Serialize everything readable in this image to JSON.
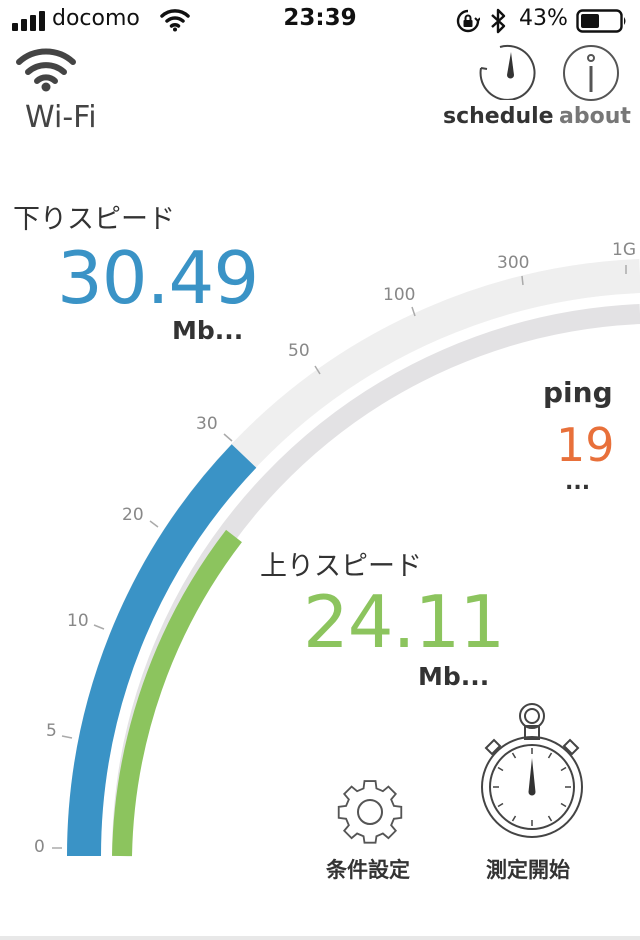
{
  "status_bar": {
    "carrier": "docomo",
    "time": "23:39",
    "battery_percent": "43%",
    "icons": [
      "signal-icon",
      "wifi-icon",
      "orientation-lock-icon",
      "bluetooth-icon",
      "battery-icon"
    ]
  },
  "header": {
    "connection_type": "Wi-Fi",
    "connection_icon": "wifi-icon",
    "schedule_label": "schedule",
    "about_label": "about"
  },
  "download": {
    "title": "下りスピード",
    "value": "30.49",
    "unit": "Mb...",
    "color": "#3a93c6"
  },
  "upload": {
    "title": "上りスピード",
    "value": "24.11",
    "unit": "Mb...",
    "color": "#8cc45e"
  },
  "ping": {
    "title": "ping",
    "value": "19",
    "unit": "...",
    "color": "#e8703a"
  },
  "gauge": {
    "ticks": [
      "0",
      "5",
      "10",
      "20",
      "30",
      "50",
      "100",
      "300",
      "1G"
    ]
  },
  "actions": {
    "settings_label": "条件設定",
    "start_label": "測定開始"
  },
  "colors": {
    "track_outer": "#efefef",
    "track_inner": "#e3e2e4",
    "accent_blue": "#3a93c6",
    "accent_green": "#8cc45e",
    "ping_orange": "#e8703a"
  }
}
